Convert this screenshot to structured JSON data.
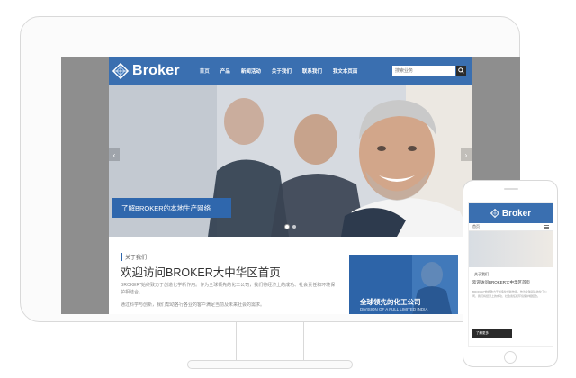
{
  "colors": {
    "brand": "#3a6fb0",
    "accent": "#2f67ad"
  },
  "desktop": {
    "brand_name": "Broker",
    "menu": [
      "首页",
      "产品",
      "新闻活动",
      "关于我们",
      "联系我们",
      "我文本页面"
    ],
    "search_placeholder": "搜索业务",
    "hero": {
      "caption": "了解BROKER的本地生产网络",
      "prev_icon": "chevron-left-icon",
      "next_icon": "chevron-right-icon"
    },
    "about": {
      "tag": "关于我们",
      "title": "欢迎访问BROKER大中华区首页",
      "paragraph1": "BROKER*始终致力于创造化学新作用。作为全球领先的化工公司，我们将经济上的成功、社会责任和环境保护相结合。",
      "paragraph2": "通过科学与创新，我们帮助各行各业的客户满足当前及未来社会的需求。"
    },
    "card": {
      "title": "全球领先的化工公司",
      "subtitle": "DIVISION OF A FULL LIMITED INDIA"
    }
  },
  "phone": {
    "brand_name": "Broker",
    "nav_label": "首页",
    "about_tag": "关于我们",
    "about_title": "欢迎访问BROKER大中华区首页",
    "button_label": "了解更多"
  }
}
